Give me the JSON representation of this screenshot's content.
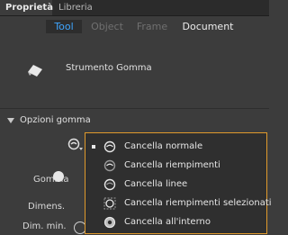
{
  "panel": {
    "tabs": [
      "Proprietà",
      "Libreria"
    ]
  },
  "segmented": {
    "items": [
      "Tool",
      "Object",
      "Frame",
      "Document"
    ],
    "selected": "Tool"
  },
  "tool": {
    "icon": "eraser-icon",
    "name": "Strumento Gomma"
  },
  "section": {
    "title": "Opzioni gomma",
    "rows": [
      "Gomma",
      "Dimens.",
      "Dim. min."
    ]
  },
  "menu": {
    "items": [
      {
        "label": "Cancella normale",
        "icon": "erase-normal-icon",
        "checked": true
      },
      {
        "label": "Cancella riempimenti",
        "icon": "erase-fills-icon",
        "checked": false
      },
      {
        "label": "Cancella linee",
        "icon": "erase-lines-icon",
        "checked": false
      },
      {
        "label": "Cancella riempimenti selezionati",
        "icon": "erase-selected-fills-icon",
        "checked": false
      },
      {
        "label": "Cancella all'interno",
        "icon": "erase-inside-icon",
        "checked": false
      }
    ]
  },
  "colors": {
    "accent": "#3fa6ff",
    "menu_border": "#e09a2c",
    "background": "#3c3c3c"
  }
}
